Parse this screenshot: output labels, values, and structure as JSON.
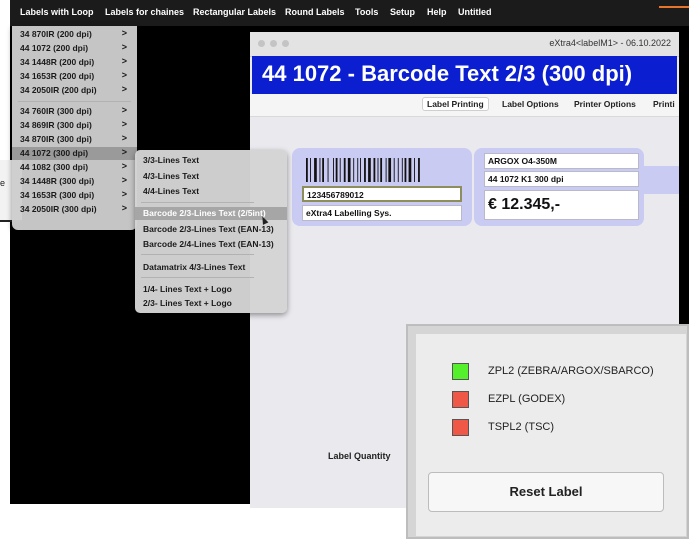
{
  "menubar": {
    "items": [
      "Labels with Loop",
      "Labels for chaines",
      "Rectangular Labels",
      "Round Labels",
      "Tools",
      "Setup",
      "Help",
      "Untitled"
    ]
  },
  "left_clip": {
    "text": "e"
  },
  "dropdown": {
    "items": [
      {
        "label": "34 870IR (200 dpi)",
        "chevron": ">"
      },
      {
        "label": "44 1072 (200 dpi)",
        "chevron": ">"
      },
      {
        "label": "34 1448R (200 dpi)",
        "chevron": ">"
      },
      {
        "label": "34 1653R (200 dpi)",
        "chevron": ">"
      },
      {
        "label": "34 2050IR (200 dpi)",
        "chevron": ">"
      },
      {
        "label": "34 760IR (300 dpi)",
        "chevron": ">"
      },
      {
        "label": "34 869IR (300 dpi)",
        "chevron": ">"
      },
      {
        "label": "34 870IR (300 dpi)",
        "chevron": ">"
      },
      {
        "label": "44 1072 (300 dpi)",
        "chevron": ">"
      },
      {
        "label": "44 1082 (300 dpi)",
        "chevron": ">"
      },
      {
        "label": "34 1448R (300 dpi)",
        "chevron": ">"
      },
      {
        "label": "34 1653R (300 dpi)",
        "chevron": ">"
      },
      {
        "label": "34 2050IR (300 dpi)",
        "chevron": ">"
      }
    ],
    "selected_index": 8
  },
  "submenu": {
    "items": [
      "3/3-Lines Text",
      "4/3-Lines Text",
      "4/4-Lines Text",
      "Barcode 2/3-Lines Text (2/5int)",
      "Barcode 2/3-Lines Text (EAN-13)",
      "Barcode 2/4-Lines Text (EAN-13)",
      "Datamatrix 4/3-Lines Text",
      "1/4- Lines Text + Logo",
      "2/3- Lines Text + Logo"
    ],
    "selected_index": 3
  },
  "window": {
    "title": "eXtra4<labelM1> - 06.10.2022",
    "header": "44 1072 - Barcode Text 2/3 (300 dpi)",
    "tabs": [
      "Label Printing",
      "Label Options",
      "Printer Options",
      "Printi"
    ],
    "active_tab": "Label Printing"
  },
  "label": {
    "barcode_number": "123456789012",
    "company": "eXtra4 Labelling Sys.",
    "model": "ARGOX O4-350M",
    "dpi_line": "44 1072 K1 300 dpi",
    "price": "€ 12.345,-"
  },
  "quantity_label": "Label Quantity",
  "printer_languages": [
    {
      "label": "ZPL2 (ZEBRA/ARGOX/SBARCO)",
      "color": "#55f02c",
      "status": "active"
    },
    {
      "label": "EZPL (GODEX)",
      "color": "#ef5746",
      "status": "inactive"
    },
    {
      "label": "TSPL2 (TSC)",
      "color": "#ef5746",
      "status": "inactive"
    }
  ],
  "reset_button": "Reset Label",
  "colors": {
    "header_blue": "#0b1fd0",
    "label_bg": "#c9cbf3",
    "active": "#55f02c",
    "inactive": "#ef5746"
  }
}
